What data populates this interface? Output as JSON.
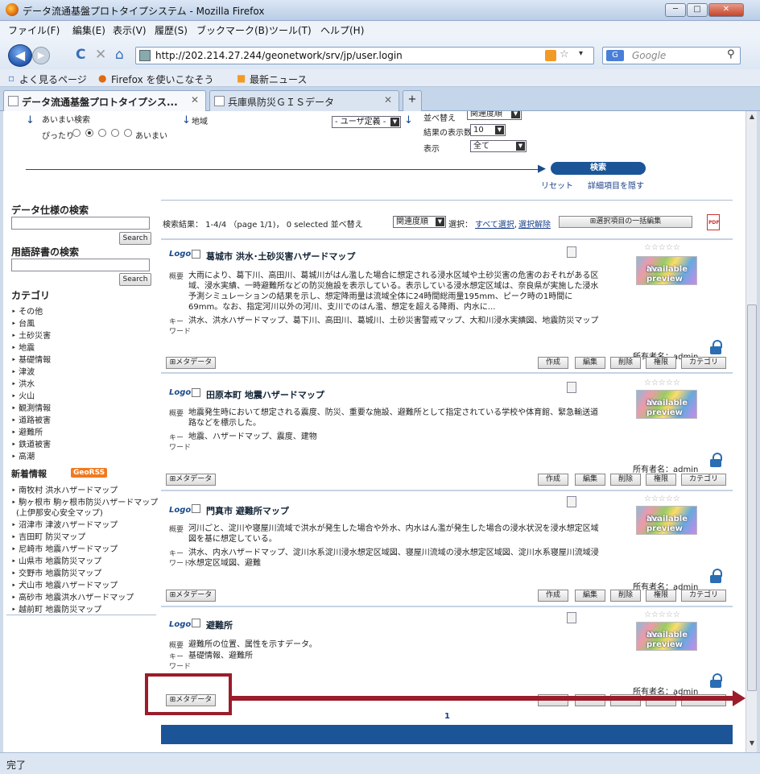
{
  "window": {
    "title": "データ流通基盤プロトタイプシステム - Mozilla Firefox",
    "min": "─",
    "max": "□",
    "close": "✕"
  },
  "menu": [
    "ファイル(F)",
    "編集(E)",
    "表示(V)",
    "履歴(S)",
    "ブックマーク(B)",
    "ツール(T)",
    "ヘルプ(H)"
  ],
  "nav": {
    "back": "◀",
    "forward": "▶",
    "reload": "C",
    "stop": "✕",
    "home": "⌂",
    "url": "http://202.214.27.244/geonetwork/srv/jp/user.login",
    "search_placeholder": "Google",
    "search_engine": "G"
  },
  "bookmarks": [
    "よく見るページ",
    "Firefox を使いこなそう",
    "最新ニュース"
  ],
  "tabs": [
    {
      "label": "データ流通基盤プロトタイプシス...",
      "close": "✕"
    },
    {
      "label": "兵庫県防災ＧＩＳデータ",
      "close": "✕"
    }
  ],
  "tab_new": "+",
  "status": "完了",
  "search_options": {
    "fuzzy_label": "あいまい検索",
    "exact": "ぴったり",
    "fuzzy": "あいまい",
    "region_label": "地域",
    "region_value": "- ユーザ定義 -",
    "sort_label": "並べ替え",
    "sort_value": "関連度順",
    "count_label": "結果の表示数",
    "count_value": "10",
    "display_label": "表示",
    "display_value": "全て",
    "search_button": "検索",
    "reset": "リセット",
    "hide_details": "詳細項目を隠す"
  },
  "sidebar": {
    "data_search_title": "データ仕様の検索",
    "search_button": "Search",
    "glossary_title": "用語辞書の検索",
    "glossary_button": "Search",
    "category_title": "カテゴリ",
    "categories": [
      "その他",
      "台風",
      "土砂災害",
      "地震",
      "基礎情報",
      "津波",
      "洪水",
      "火山",
      "観測情報",
      "道路被害",
      "避難所",
      "鉄道被害",
      "高潮"
    ],
    "news_title": "新着情報",
    "georss": "GeoRSS",
    "news": [
      "南牧村 洪水ハザードマップ",
      "駒ヶ根市 駒ヶ根市防災ハザードマップ",
      "(上伊那安心安全マップ)",
      "沼津市 津波ハザードマップ",
      "吉田町 防災マップ",
      "尼崎市 地震ハザードマップ",
      "山県市 地震防災マップ",
      "交野市 地震防災マップ",
      "犬山市 地震ハザードマップ",
      "高砂市 地震洪水ハザードマップ",
      "越前町 地震防災マップ"
    ]
  },
  "results_header": {
    "summary": "検索結果： 1-4/4 （page 1/1)， 0 selected 並べ替え",
    "sort_value": "関連度順",
    "select_label": "選択：",
    "select_all": "すべて選択",
    "deselect": "選択解除",
    "bulk_edit": "⊞選択項目の一括編集"
  },
  "results": [
    {
      "title": "葛城市 洪水･土砂災害ハザードマップ",
      "summary": "大雨により、葛下川、高田川、葛城川がはん濫した場合に想定される浸水区域や土砂災害の危害のおそれがある区域、浸水実績、一時避難所などの防災施設を表示している。表示している浸水想定区域は、奈良県が実施した浸水予測シミュレーションの結果を示し、想定降雨量は流域全体に24時間総雨量195mm、ピーク時の1時間に69mm。なお、指定河川以外の河川、支川でのはん濫、想定を超える降雨、内水に...",
      "keywords": "洪水、洪水ハザードマップ、葛下川、高田川、葛城川、土砂災害警戒マップ、大和川浸水実績図、地震防災マップ",
      "owner": "所有者名：admin"
    },
    {
      "title": "田原本町 地震ハザードマップ",
      "summary": "地震発生時において想定される震度、防災、重要な施設、避難所として指定されている学校や体育館、緊急輸送道路などを標示した。",
      "keywords": "地震、ハザードマップ、震度、建物",
      "owner": "所有者名：admin"
    },
    {
      "title": "門真市 避難所マップ",
      "summary": "河川ごと、淀川や寝屋川流域で洪水が発生した場合や外水、内水はん濫が発生した場合の浸水状況を浸水想定区域図を基に想定している。",
      "keywords": "洪水、内水ハザードマップ、淀川水系淀川浸水想定区域図、寝屋川流域の浸水想定区域図、淀川水系寝屋川流域浸水想定区域図、避難",
      "owner": "所有者名：admin"
    },
    {
      "title": "避難所",
      "summary": "避難所の位置、属性を示すデータ。",
      "keywords": "基礎情報、避難所",
      "owner": "所有者名：admin"
    }
  ],
  "labels": {
    "logo": "Logo",
    "summary": "概要",
    "keywords1": "キー",
    "keywords2": "ワード",
    "no_preview": "No preview",
    "available": "available",
    "stars": "☆☆☆☆☆",
    "metadata": "⊞メタデータ",
    "create": "作成",
    "edit": "編集",
    "delete": "削除",
    "privileges": "権限",
    "category": "カテゴリ"
  },
  "pagination": "1"
}
